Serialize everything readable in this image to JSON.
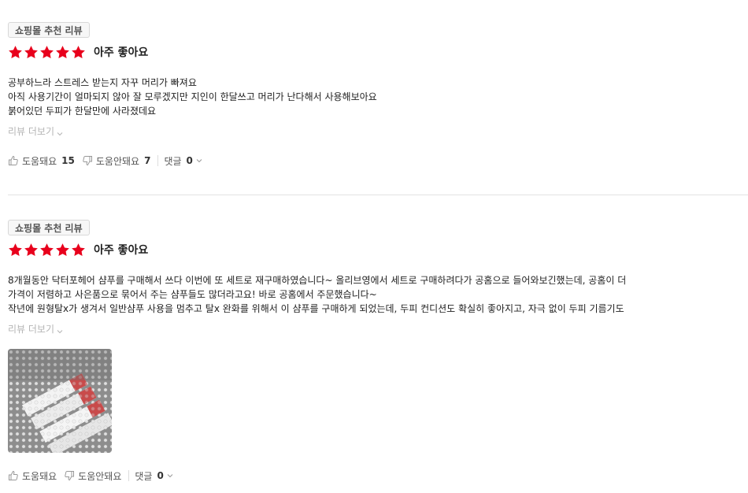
{
  "reviews": [
    {
      "badge": "쇼핑몰 추천 리뷰",
      "stars": 5,
      "rating_text": "아주 좋아요",
      "lines": [
        "공부하느라 스트레스 받는지 자꾸 머리가 빠져요",
        "아직 사용기간이 얼마되지 않아 잘 모루겠지만 지인이 한달쓰고 머리가 난다해서 사용해보아요",
        "붉어있던 두피가 한달만에 사라졌데요"
      ],
      "more_label": "리뷰 더보기",
      "helpful_label": "도움돼요",
      "helpful_count": "15",
      "unhelpful_label": "도움안돼요",
      "unhelpful_count": "7",
      "comment_label": "댓글",
      "comment_count": "0"
    },
    {
      "badge": "쇼핑몰 추천 리뷰",
      "stars": 5,
      "rating_text": "아주 좋아요",
      "lines": [
        "8개월동안 닥터포헤어 샴푸를 구매해서 쓰다 이번에 또 세트로 재구매하였습니다~ 올리브영에서 세트로 구매하려다가 공홈으로 들어와보긴했는데, 공홈이 더",
        "가격이 저렴하고 사은품으로 묶어서 주는 샴푸들도 많더라고요! 바로 공홈에서 주문했습니다~",
        "작년에 원형탈x가 생겨서 일반샴푸 사용을 멈추고 탈x 완화를 위해서 이 샴푸를 구매하게 되었는데, 두피 컨디션도 확실히 좋아지고, 자극 없이 두피 기름기도"
      ],
      "more_label": "리뷰 더보기",
      "helpful_label": "도움돼요",
      "unhelpful_label": "도움안돼요",
      "comment_label": "댓글",
      "comment_count": "0"
    }
  ],
  "colors": {
    "star": "#e8001c",
    "muted": "#b5b5b5",
    "divider": "#e3e3e3"
  },
  "icons": [
    "star-icon",
    "thumbs-up-icon",
    "thumbs-down-icon",
    "chevron-down-icon"
  ]
}
